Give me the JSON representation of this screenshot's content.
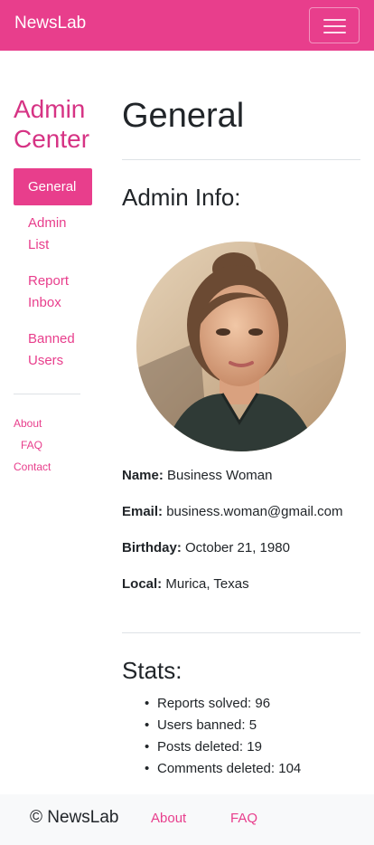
{
  "navbar": {
    "brand": "NewsLab",
    "toggle_icon": "hamburger-menu-icon"
  },
  "sidebar": {
    "title": "Admin Center",
    "items": [
      {
        "label": "General",
        "active": true
      },
      {
        "label": "Admin List",
        "active": false
      },
      {
        "label": "Report Inbox",
        "active": false
      },
      {
        "label": "Banned Users",
        "active": false
      }
    ],
    "sub_links": [
      "About",
      "FAQ",
      "Contact"
    ]
  },
  "main": {
    "title": "General",
    "admin_info_heading": "Admin Info:",
    "profile": {
      "name_label": "Name:",
      "name": "Business Woman",
      "email_label": "Email:",
      "email": "business.woman@gmail.com",
      "birthday_label": "Birthday:",
      "birthday": "October 21, 1980",
      "local_label": "Local:",
      "local": "Murica, Texas"
    },
    "stats_heading": "Stats:",
    "stats": [
      "Reports solved: 96",
      "Users banned: 5",
      "Posts deleted: 19",
      "Comments deleted: 104"
    ]
  },
  "footer": {
    "copyright": "© NewsLab",
    "links": [
      "About",
      "FAQ"
    ]
  },
  "colors": {
    "accent": "#e83e8c",
    "footer_bg": "#f8f9fa",
    "text": "#212529"
  }
}
